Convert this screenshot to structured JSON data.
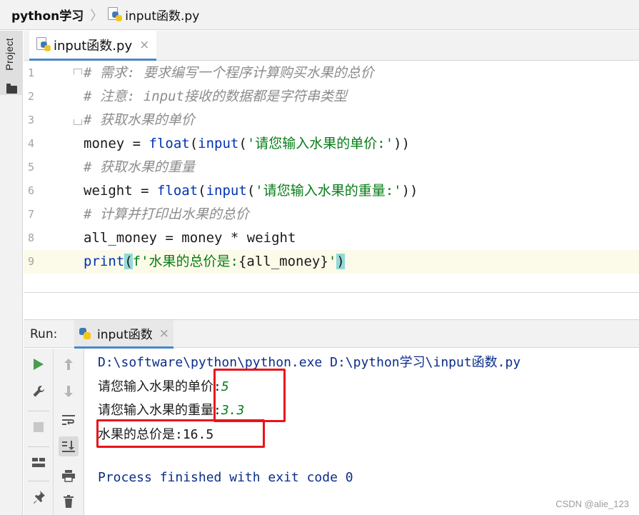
{
  "breadcrumb": {
    "project": "python学习",
    "separator": "〉",
    "file": "input函数.py"
  },
  "sidebar": {
    "project_tab": "Project"
  },
  "editor_tab": {
    "label": "input函数.py",
    "close": "×"
  },
  "editor": {
    "lines": [
      {
        "num": "1",
        "text": "# 需求: 要求编写一个程序计算购买水果的总价"
      },
      {
        "num": "2",
        "text": "# 注意: input接收的数据都是字符串类型"
      },
      {
        "num": "3",
        "text": "# 获取水果的单价"
      },
      {
        "num": "4",
        "t1": "money = ",
        "kw1": "float",
        "t2": "(",
        "kw2": "input",
        "t3": "(",
        "str": "'请您输入水果的单价:'",
        "t4": "))"
      },
      {
        "num": "5",
        "text": "# 获取水果的重量"
      },
      {
        "num": "6",
        "t1": "weight = ",
        "kw1": "float",
        "t2": "(",
        "kw2": "input",
        "t3": "(",
        "str": "'请您输入水果的重量:'",
        "t4": "))"
      },
      {
        "num": "7",
        "text": "# 计算并打印出水果的总价"
      },
      {
        "num": "8",
        "text": "all_money = money * weight"
      },
      {
        "num": "9",
        "kw1": "print",
        "paren_open": "(",
        "s1": "f'水果的总价是:",
        "expr": "{all_money}",
        "s2": "'",
        "paren_close": ")"
      }
    ]
  },
  "run_panel": {
    "label": "Run:",
    "tab_label": "input函数",
    "tab_close": "×",
    "console": {
      "command": "D:\\software\\python\\python.exe D:\\python学习\\input函数.py",
      "prompt1": "请您输入水果的单价:",
      "input1": "5",
      "prompt2": "请您输入水果的重量:",
      "input2": "3.3",
      "result": "水果的总价是:16.5",
      "exit": "Process finished with exit code 0"
    }
  },
  "watermark": "CSDN @alie_123"
}
